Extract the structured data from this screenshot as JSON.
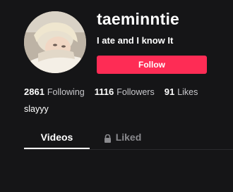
{
  "profile": {
    "username": "taeminntie",
    "nickname": "I ate and I know It",
    "follow_label": "Follow",
    "bio": "slayyy"
  },
  "stats": [
    {
      "value": "2861",
      "label": "Following"
    },
    {
      "value": "1116",
      "label": "Followers"
    },
    {
      "value": "91",
      "label": "Likes"
    }
  ],
  "tabs": [
    {
      "label": "Videos",
      "active": true
    },
    {
      "label": "Liked",
      "active": false,
      "icon": "lock-icon"
    }
  ],
  "colors": {
    "background": "#151517",
    "accent": "#fe2c55",
    "muted_text": "#8a8a8e"
  },
  "icons": {
    "avatar": "profile-photo",
    "liked_tab": "lock-icon"
  }
}
